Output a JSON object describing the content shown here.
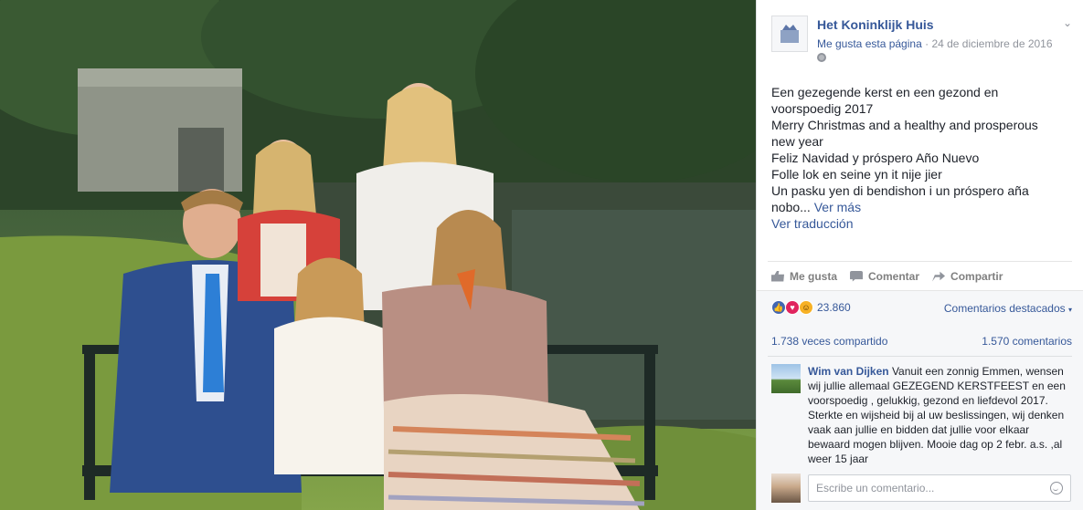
{
  "photo": {
    "description_icon": "family-photo"
  },
  "page": {
    "name": "Het Koninklijk Huis",
    "like_link": "Me gusta esta página",
    "date": "24 de diciembre de 2016"
  },
  "post": {
    "lines": [
      "Een gezegende kerst en een gezond en",
      "voorspoedig 2017",
      "Merry Christmas and a healthy and prosperous",
      "new year",
      "Feliz Navidad y próspero Año Nuevo",
      "Folle lok en seine yn it nije jier",
      "Un pasku yen di bendishon i un próspero aña",
      "nobo..."
    ],
    "see_more": "Ver más",
    "translate": "Ver traducción"
  },
  "actions": {
    "like": "Me gusta",
    "comment": "Comentar",
    "share": "Compartir"
  },
  "reactions": {
    "count": "23.860",
    "featured": "Comentarios destacados"
  },
  "stats": {
    "shares": "1.738 veces compartido",
    "comments": "1.570 comentarios"
  },
  "comment": {
    "author": "Wim van Dijken",
    "text": "Vanuit een zonnig Emmen, wensen wij jullie allemaal GEZEGEND KERSTFEEST en een voorspoedig , gelukkig, gezond en liefdevol 2017. Sterkte en wijsheid bij al uw beslissingen, wij denken vaak aan jullie en bidden dat jullie voor elkaar bewaard mogen blijven. Mooie dag op 2 febr. a.s. ,al weer 15 jaar"
  },
  "composer": {
    "placeholder": "Escribe un comentario..."
  },
  "colors": {
    "link": "#365899",
    "text": "#1d2129",
    "muted": "#90949c"
  }
}
